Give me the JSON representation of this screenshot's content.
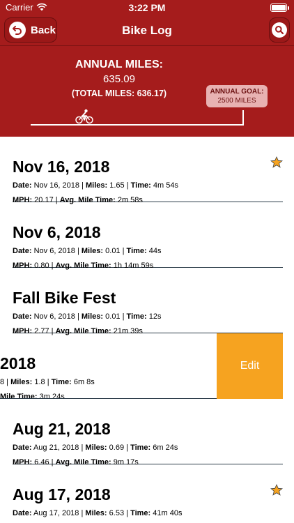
{
  "status": {
    "carrier": "Carrier",
    "time": "3:22 PM"
  },
  "nav": {
    "back_label": "Back",
    "title": "Bike Log"
  },
  "summary": {
    "annual_label": "ANNUAL MILES:",
    "annual_value": "635.09",
    "total_label": "(TOTAL MILES: 636.17)",
    "goal_label": "ANNUAL GOAL:",
    "goal_value": "2500 MILES",
    "progress_fraction": 0.254
  },
  "colors": {
    "brand": "#a51c1c",
    "edit": "#f6a320",
    "star": "#f6a320"
  },
  "entries": [
    {
      "title": "Nov 16, 2018",
      "date": "Nov 16, 2018",
      "miles": "1.65",
      "time": "4m 54s",
      "mph": "20.17",
      "avg": "2m 58s",
      "starred": true
    },
    {
      "title": "Nov 6, 2018",
      "date": "Nov 6, 2018",
      "miles": "0.01",
      "time": "44s",
      "mph": "0.80",
      "avg": "1h 14m 59s",
      "starred": false
    },
    {
      "title": "Fall Bike Fest",
      "date": "Nov 6, 2018",
      "miles": "0.01",
      "time": "12s",
      "mph": "2.77",
      "avg": "21m 39s",
      "starred": false
    },
    {
      "title": "2018",
      "line1_prefix": "8 |",
      "miles": "1.8",
      "time": "6m 8s",
      "line2_prefix": "Mile Time:",
      "avg": "3m 24s",
      "edit_label": "Edit"
    },
    {
      "title": "Aug 21, 2018",
      "date": "Aug 21, 2018",
      "miles": "0.69",
      "time": "6m 24s",
      "mph": "6.46",
      "avg": "9m 17s",
      "starred": false
    },
    {
      "title": "Aug 17, 2018",
      "date": "Aug 17, 2018",
      "miles": "6.53",
      "time": "41m 40s",
      "starred": true
    }
  ],
  "labels": {
    "date": "Date:",
    "miles": "Miles:",
    "time": "Time:",
    "mph": "MPH:",
    "avg": "Avg. Mile Time:",
    "sep": " | "
  }
}
